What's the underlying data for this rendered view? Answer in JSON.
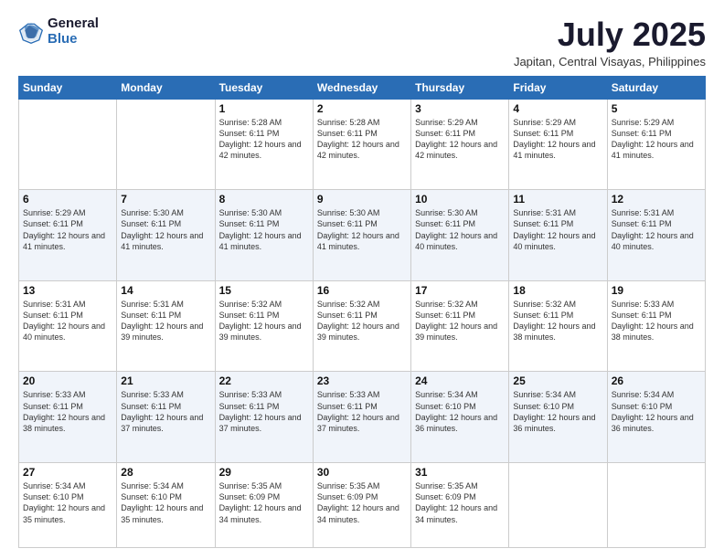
{
  "logo": {
    "general": "General",
    "blue": "Blue"
  },
  "title": "July 2025",
  "subtitle": "Japitan, Central Visayas, Philippines",
  "weekdays": [
    "Sunday",
    "Monday",
    "Tuesday",
    "Wednesday",
    "Thursday",
    "Friday",
    "Saturday"
  ],
  "weeks": [
    [
      {
        "day": "",
        "info": ""
      },
      {
        "day": "",
        "info": ""
      },
      {
        "day": "1",
        "info": "Sunrise: 5:28 AM\nSunset: 6:11 PM\nDaylight: 12 hours and 42 minutes."
      },
      {
        "day": "2",
        "info": "Sunrise: 5:28 AM\nSunset: 6:11 PM\nDaylight: 12 hours and 42 minutes."
      },
      {
        "day": "3",
        "info": "Sunrise: 5:29 AM\nSunset: 6:11 PM\nDaylight: 12 hours and 42 minutes."
      },
      {
        "day": "4",
        "info": "Sunrise: 5:29 AM\nSunset: 6:11 PM\nDaylight: 12 hours and 41 minutes."
      },
      {
        "day": "5",
        "info": "Sunrise: 5:29 AM\nSunset: 6:11 PM\nDaylight: 12 hours and 41 minutes."
      }
    ],
    [
      {
        "day": "6",
        "info": "Sunrise: 5:29 AM\nSunset: 6:11 PM\nDaylight: 12 hours and 41 minutes."
      },
      {
        "day": "7",
        "info": "Sunrise: 5:30 AM\nSunset: 6:11 PM\nDaylight: 12 hours and 41 minutes."
      },
      {
        "day": "8",
        "info": "Sunrise: 5:30 AM\nSunset: 6:11 PM\nDaylight: 12 hours and 41 minutes."
      },
      {
        "day": "9",
        "info": "Sunrise: 5:30 AM\nSunset: 6:11 PM\nDaylight: 12 hours and 41 minutes."
      },
      {
        "day": "10",
        "info": "Sunrise: 5:30 AM\nSunset: 6:11 PM\nDaylight: 12 hours and 40 minutes."
      },
      {
        "day": "11",
        "info": "Sunrise: 5:31 AM\nSunset: 6:11 PM\nDaylight: 12 hours and 40 minutes."
      },
      {
        "day": "12",
        "info": "Sunrise: 5:31 AM\nSunset: 6:11 PM\nDaylight: 12 hours and 40 minutes."
      }
    ],
    [
      {
        "day": "13",
        "info": "Sunrise: 5:31 AM\nSunset: 6:11 PM\nDaylight: 12 hours and 40 minutes."
      },
      {
        "day": "14",
        "info": "Sunrise: 5:31 AM\nSunset: 6:11 PM\nDaylight: 12 hours and 39 minutes."
      },
      {
        "day": "15",
        "info": "Sunrise: 5:32 AM\nSunset: 6:11 PM\nDaylight: 12 hours and 39 minutes."
      },
      {
        "day": "16",
        "info": "Sunrise: 5:32 AM\nSunset: 6:11 PM\nDaylight: 12 hours and 39 minutes."
      },
      {
        "day": "17",
        "info": "Sunrise: 5:32 AM\nSunset: 6:11 PM\nDaylight: 12 hours and 39 minutes."
      },
      {
        "day": "18",
        "info": "Sunrise: 5:32 AM\nSunset: 6:11 PM\nDaylight: 12 hours and 38 minutes."
      },
      {
        "day": "19",
        "info": "Sunrise: 5:33 AM\nSunset: 6:11 PM\nDaylight: 12 hours and 38 minutes."
      }
    ],
    [
      {
        "day": "20",
        "info": "Sunrise: 5:33 AM\nSunset: 6:11 PM\nDaylight: 12 hours and 38 minutes."
      },
      {
        "day": "21",
        "info": "Sunrise: 5:33 AM\nSunset: 6:11 PM\nDaylight: 12 hours and 37 minutes."
      },
      {
        "day": "22",
        "info": "Sunrise: 5:33 AM\nSunset: 6:11 PM\nDaylight: 12 hours and 37 minutes."
      },
      {
        "day": "23",
        "info": "Sunrise: 5:33 AM\nSunset: 6:11 PM\nDaylight: 12 hours and 37 minutes."
      },
      {
        "day": "24",
        "info": "Sunrise: 5:34 AM\nSunset: 6:10 PM\nDaylight: 12 hours and 36 minutes."
      },
      {
        "day": "25",
        "info": "Sunrise: 5:34 AM\nSunset: 6:10 PM\nDaylight: 12 hours and 36 minutes."
      },
      {
        "day": "26",
        "info": "Sunrise: 5:34 AM\nSunset: 6:10 PM\nDaylight: 12 hours and 36 minutes."
      }
    ],
    [
      {
        "day": "27",
        "info": "Sunrise: 5:34 AM\nSunset: 6:10 PM\nDaylight: 12 hours and 35 minutes."
      },
      {
        "day": "28",
        "info": "Sunrise: 5:34 AM\nSunset: 6:10 PM\nDaylight: 12 hours and 35 minutes."
      },
      {
        "day": "29",
        "info": "Sunrise: 5:35 AM\nSunset: 6:09 PM\nDaylight: 12 hours and 34 minutes."
      },
      {
        "day": "30",
        "info": "Sunrise: 5:35 AM\nSunset: 6:09 PM\nDaylight: 12 hours and 34 minutes."
      },
      {
        "day": "31",
        "info": "Sunrise: 5:35 AM\nSunset: 6:09 PM\nDaylight: 12 hours and 34 minutes."
      },
      {
        "day": "",
        "info": ""
      },
      {
        "day": "",
        "info": ""
      }
    ]
  ]
}
